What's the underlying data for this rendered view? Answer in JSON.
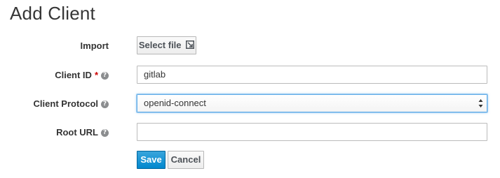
{
  "page": {
    "title": "Add Client"
  },
  "form": {
    "import": {
      "label": "Import",
      "button_label": "Select file",
      "icon": "file-import-icon"
    },
    "client_id": {
      "label": "Client ID",
      "required_marker": "*",
      "help_icon": "help-icon",
      "value": "gitlab"
    },
    "client_protocol": {
      "label": "Client Protocol",
      "help_icon": "help-icon",
      "selected": "openid-connect"
    },
    "root_url": {
      "label": "Root URL",
      "help_icon": "help-icon",
      "value": ""
    },
    "actions": {
      "save_label": "Save",
      "cancel_label": "Cancel"
    }
  },
  "colors": {
    "primary": "#0088ce",
    "focus_border": "#66afe9",
    "required": "#cc0000"
  }
}
